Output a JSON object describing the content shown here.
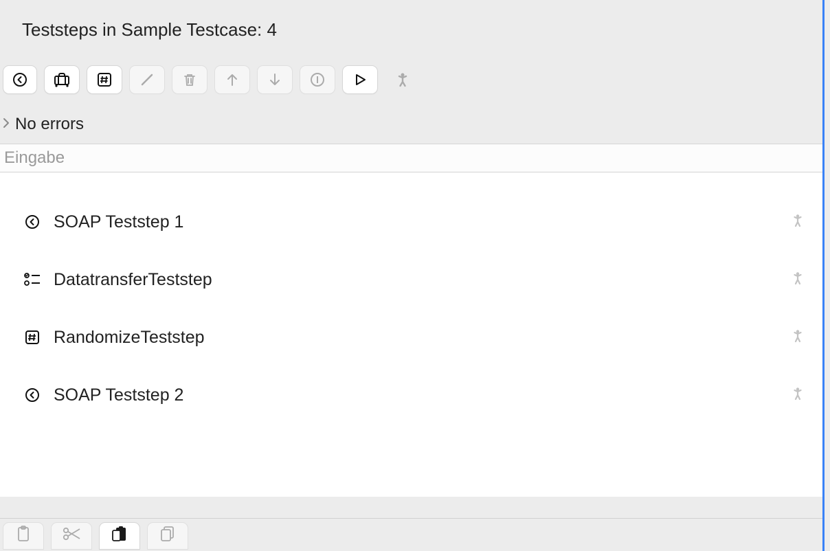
{
  "header": {
    "title": "Teststeps in Sample Testcase: 4"
  },
  "toolbar": {
    "buttons": [
      {
        "name": "soap-request-button",
        "enabled": true
      },
      {
        "name": "datatransfer-button",
        "enabled": true
      },
      {
        "name": "randomize-button",
        "enabled": true
      },
      {
        "name": "edit-button",
        "enabled": false
      },
      {
        "name": "delete-button",
        "enabled": false
      },
      {
        "name": "move-up-button",
        "enabled": false
      },
      {
        "name": "move-down-button",
        "enabled": false
      },
      {
        "name": "info-button",
        "enabled": false
      },
      {
        "name": "run-button",
        "enabled": true
      }
    ],
    "person_icon": "person-icon"
  },
  "status": {
    "text": "No errors"
  },
  "filter_input": {
    "placeholder": "Eingabe",
    "value": ""
  },
  "teststeps": [
    {
      "icon": "soap-icon",
      "label": "SOAP Teststep 1"
    },
    {
      "icon": "transfer-icon",
      "label": "DatatransferTeststep"
    },
    {
      "icon": "hash-icon",
      "label": "RandomizeTeststep"
    },
    {
      "icon": "soap-icon",
      "label": "SOAP Teststep 2"
    }
  ],
  "bottombar": {
    "buttons": [
      {
        "name": "clipboard-copy-button",
        "enabled": false
      },
      {
        "name": "cut-button",
        "enabled": false
      },
      {
        "name": "clipboard-active-button",
        "enabled": true
      },
      {
        "name": "duplicate-button",
        "enabled": false
      }
    ]
  }
}
